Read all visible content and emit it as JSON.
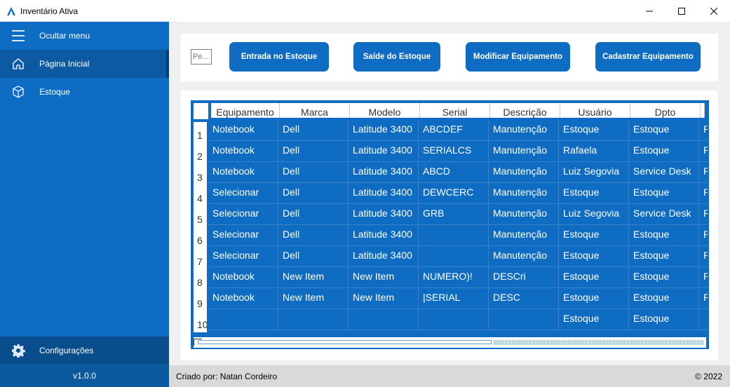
{
  "window": {
    "title": "Inventário Ativa",
    "controls": [
      "minimize-icon",
      "maximize-icon",
      "close-icon"
    ]
  },
  "sidebar": {
    "items": [
      {
        "label": "Ocultar menu",
        "icon": "menu-icon"
      },
      {
        "label": "Página Inicial",
        "icon": "home-icon",
        "active": true
      },
      {
        "label": "Estoque",
        "icon": "box-icon"
      }
    ],
    "settings": {
      "label": "Configurações",
      "icon": "gear-icon"
    },
    "version": "v1.0.0"
  },
  "toolbar": {
    "search_placeholder": "Pe...",
    "buttons": [
      {
        "label": "Entrada no Estoque"
      },
      {
        "label": "Saíde do Estoque"
      },
      {
        "label": "Modificar Equipamento"
      },
      {
        "label": "Cadastrar Equipamento"
      }
    ]
  },
  "grid": {
    "columns": [
      "Equipamento",
      "Marca",
      "Modelo",
      "Serial",
      "Descrição",
      "Usuário",
      "Dpto",
      ""
    ],
    "row_numbers": [
      "1",
      "2",
      "3",
      "4",
      "5",
      "6",
      "7",
      "8",
      "9",
      "10"
    ],
    "rows": [
      [
        "Notebook",
        "Dell",
        "Latitude 3400",
        "ABCDEF",
        "Manutenção",
        "Estoque",
        "Estoque",
        "R"
      ],
      [
        "Notebook",
        "Dell",
        "Latitude 3400",
        "SERIALCS",
        "Manutenção",
        "Rafaela",
        "Estoque",
        "R"
      ],
      [
        "Notebook",
        "Dell",
        "Latitude 3400",
        "ABCD",
        "Manutenção",
        "Luiz Segovia",
        "Service Desk",
        "R"
      ],
      [
        "Selecionar",
        "Dell",
        "Latitude 3400",
        "DEWCERC",
        "Manutenção",
        "Estoque",
        "Estoque",
        "R"
      ],
      [
        "Selecionar",
        "Dell",
        "Latitude 3400",
        "GRB",
        "Manutenção",
        "Luiz Segovia",
        "Service Desk",
        "R"
      ],
      [
        "Selecionar",
        "Dell",
        "Latitude 3400",
        "",
        "Manutenção",
        "Estoque",
        "Estoque",
        "R"
      ],
      [
        "Selecionar",
        "Dell",
        "Latitude 3400",
        "",
        "Manutenção",
        "Estoque",
        "Estoque",
        "R"
      ],
      [
        "Notebook",
        "New Item",
        "New Item",
        "NUMERO)!",
        "DESCri",
        "Estoque",
        "Estoque",
        "R"
      ],
      [
        "Notebook",
        "New Item",
        "New Item",
        "|SERIAL",
        "DESC",
        "Estoque",
        "Estoque",
        "R"
      ],
      [
        "",
        "",
        "",
        "",
        "",
        "Estoque",
        "Estoque",
        ""
      ]
    ]
  },
  "footer": {
    "credit": "Criado por: Natan Cordeiro",
    "copyright": "© 2022"
  },
  "colors": {
    "primary": "#0e6cc2",
    "sidebar_bottom": "#0a4d8c",
    "footer_bg": "#d9d9d9",
    "main_bg": "#f0f0f0"
  }
}
